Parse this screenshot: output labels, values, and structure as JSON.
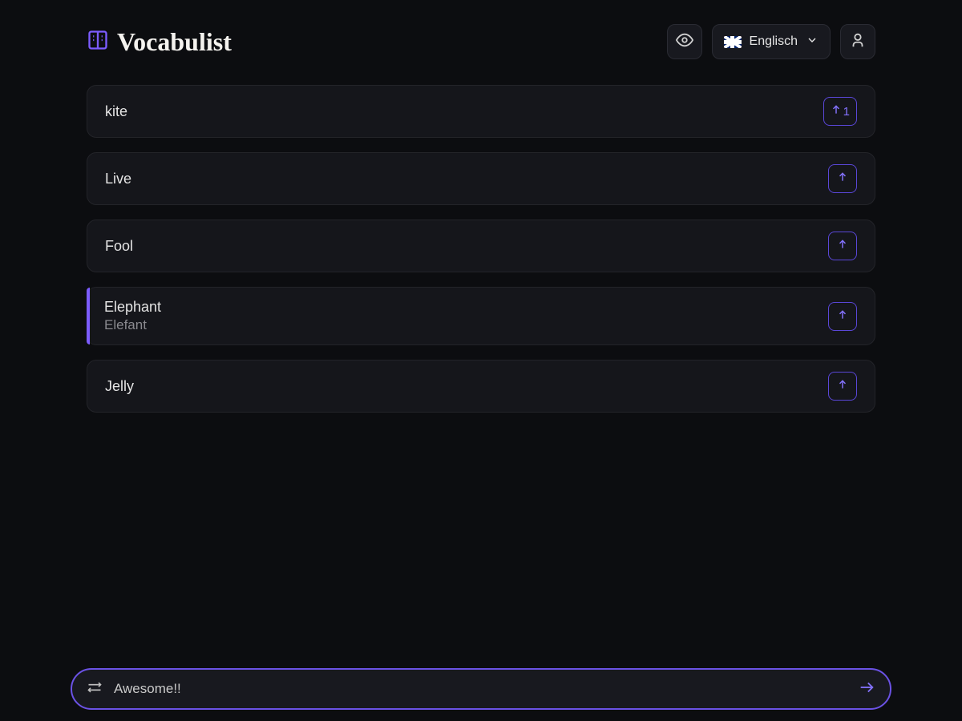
{
  "app": {
    "name": "Vocabulist"
  },
  "header": {
    "language": "Englisch"
  },
  "vocab": [
    {
      "word": "kite",
      "translation": null,
      "votes": "1",
      "active": false
    },
    {
      "word": "Live",
      "translation": null,
      "votes": null,
      "active": false
    },
    {
      "word": "Fool",
      "translation": null,
      "votes": null,
      "active": false
    },
    {
      "word": "Elephant",
      "translation": "Elefant",
      "votes": null,
      "active": true
    },
    {
      "word": "Jelly",
      "translation": null,
      "votes": null,
      "active": false
    }
  ],
  "input": {
    "value": "Awesome!!"
  },
  "colors": {
    "accent": "#7c5cff"
  }
}
